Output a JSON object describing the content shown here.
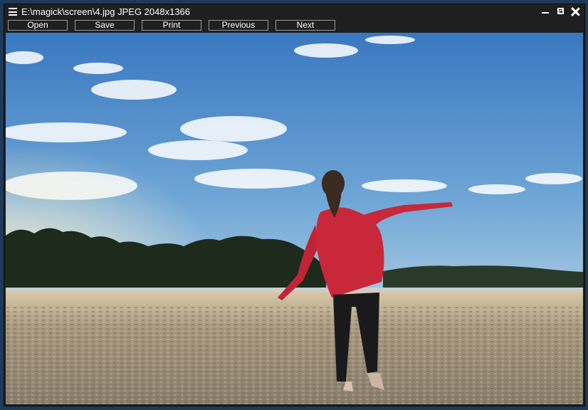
{
  "window": {
    "title": "E:\\magick\\screen\\4.jpg JPEG 2048x1366"
  },
  "toolbar": {
    "buttons": [
      {
        "label": "Open"
      },
      {
        "label": "Save"
      },
      {
        "label": "Print"
      },
      {
        "label": "Previous"
      },
      {
        "label": "Next"
      }
    ]
  },
  "icons": {
    "menu": "hamburger-menu-icon",
    "minimize": "minimize-icon",
    "maximize": "maximize-icon",
    "close": "close-icon"
  },
  "colors": {
    "titlebar": "#1f1f1f",
    "sky_top": "#3f7fc4",
    "sky_bottom": "#cfe0ea",
    "sand": "#b8a88e",
    "sweater": "#c8283a"
  }
}
